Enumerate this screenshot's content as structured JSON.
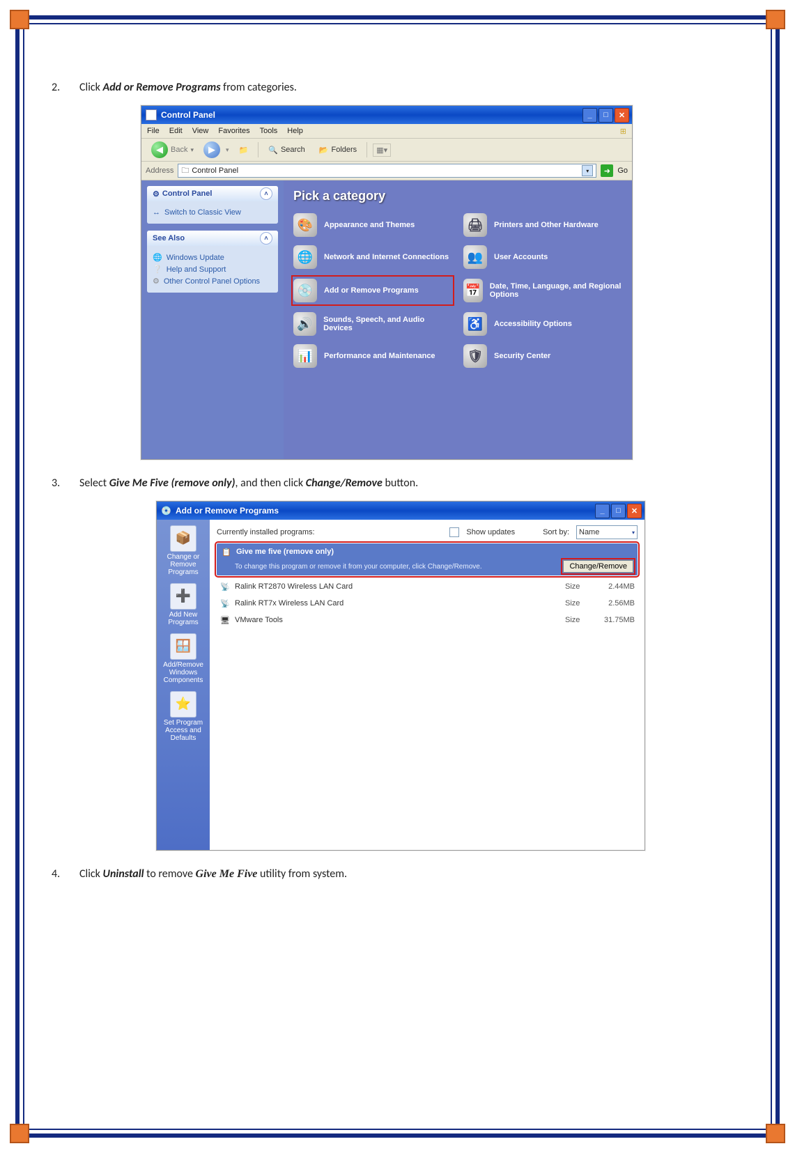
{
  "steps": {
    "s2": {
      "num": "2.",
      "pre": "Click ",
      "bold": "Add or Remove Programs",
      "post": " from categories."
    },
    "s3": {
      "num": "3.",
      "pre": "Select ",
      "bold1": "Give Me Five (remove only)",
      "mid": ", and then click ",
      "bold2": "Change/Remove",
      "post": " button."
    },
    "s4": {
      "num": "4.",
      "pre": "Click ",
      "bold1": "Uninstall",
      "mid": " to remove ",
      "bold2": "Give Me Five",
      "post": " utility from system."
    }
  },
  "cp": {
    "title": "Control Panel",
    "menu": [
      "File",
      "Edit",
      "View",
      "Favorites",
      "Tools",
      "Help"
    ],
    "toolbar": {
      "back": "Back",
      "search": "Search",
      "folders": "Folders"
    },
    "address_label": "Address",
    "address_value": "Control Panel",
    "go": "Go",
    "side_panel1_title": "Control Panel",
    "side_switch": "Switch to Classic View",
    "side_panel2_title": "See Also",
    "see_also": [
      "Windows Update",
      "Help and Support",
      "Other Control Panel Options"
    ],
    "heading": "Pick a category",
    "cats": [
      "Appearance and Themes",
      "Printers and Other Hardware",
      "Network and Internet Connections",
      "User Accounts",
      "Add or Remove Programs",
      "Date, Time, Language, and Regional Options",
      "Sounds, Speech, and Audio Devices",
      "Accessibility Options",
      "Performance and Maintenance",
      "Security Center"
    ]
  },
  "arp": {
    "title": "Add or Remove Programs",
    "side": [
      "Change or Remove Programs",
      "Add New Programs",
      "Add/Remove Windows Components",
      "Set Program Access and Defaults"
    ],
    "installed_label": "Currently installed programs:",
    "show_updates": "Show updates",
    "sort_label": "Sort by:",
    "sort_value": "Name",
    "selected": {
      "name": "Give me five (remove only)",
      "hint": "To change this program or remove it from your computer, click Change/Remove.",
      "button": "Change/Remove"
    },
    "rows": [
      {
        "name": "Ralink RT2870 Wireless LAN Card",
        "size_label": "Size",
        "size": "2.44MB"
      },
      {
        "name": "Ralink RT7x Wireless LAN Card",
        "size_label": "Size",
        "size": "2.56MB"
      },
      {
        "name": "VMware Tools",
        "size_label": "Size",
        "size": "31.75MB"
      }
    ]
  }
}
